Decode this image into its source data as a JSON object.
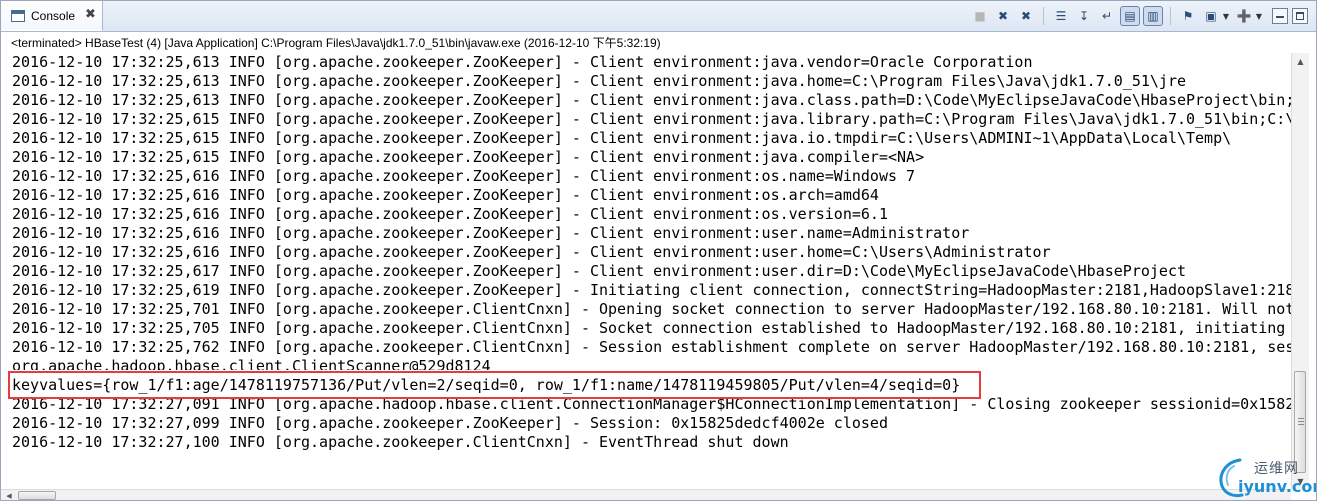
{
  "tab": {
    "title": "Console",
    "close_glyph": "✖"
  },
  "toolbar": {
    "icons": [
      {
        "name": "terminate-icon",
        "glyph": "■",
        "disabled": true
      },
      {
        "name": "remove-launch-icon",
        "glyph": "✖",
        "disabled": false
      },
      {
        "name": "remove-all-terminated-icon",
        "glyph": "✖",
        "disabled": false
      },
      {
        "name": "clear-console-icon",
        "glyph": "☰",
        "disabled": false
      },
      {
        "name": "scroll-lock-icon",
        "glyph": "↧",
        "disabled": false
      },
      {
        "name": "word-wrap-icon",
        "glyph": "↵",
        "disabled": false
      },
      {
        "name": "show-when-stdout-icon",
        "glyph": "▤",
        "pressed": true
      },
      {
        "name": "show-when-stderr-icon",
        "glyph": "▥",
        "pressed": true
      },
      {
        "name": "pin-console-icon",
        "glyph": "⚑",
        "disabled": false
      },
      {
        "name": "display-selected-console-icon",
        "glyph": "▣",
        "disabled": false
      },
      {
        "name": "open-console-icon",
        "glyph": "➕",
        "disabled": false
      }
    ]
  },
  "status": "<terminated> HBaseTest (4) [Java Application] C:\\Program Files\\Java\\jdk1.7.0_51\\bin\\javaw.exe (2016-12-10 下午5:32:19)",
  "console_lines": [
    "2016-12-10 17:32:25,613 INFO [org.apache.zookeeper.ZooKeeper] - Client environment:java.vendor=Oracle Corporation",
    "2016-12-10 17:32:25,613 INFO [org.apache.zookeeper.ZooKeeper] - Client environment:java.home=C:\\Program Files\\Java\\jdk1.7.0_51\\jre",
    "2016-12-10 17:32:25,613 INFO [org.apache.zookeeper.ZooKeeper] - Client environment:java.class.path=D:\\Code\\MyEclipseJavaCode\\HbaseProject\\bin;",
    "2016-12-10 17:32:25,615 INFO [org.apache.zookeeper.ZooKeeper] - Client environment:java.library.path=C:\\Program Files\\Java\\jdk1.7.0_51\\bin;C:\\",
    "2016-12-10 17:32:25,615 INFO [org.apache.zookeeper.ZooKeeper] - Client environment:java.io.tmpdir=C:\\Users\\ADMINI~1\\AppData\\Local\\Temp\\",
    "2016-12-10 17:32:25,615 INFO [org.apache.zookeeper.ZooKeeper] - Client environment:java.compiler=<NA>",
    "2016-12-10 17:32:25,616 INFO [org.apache.zookeeper.ZooKeeper] - Client environment:os.name=Windows 7",
    "2016-12-10 17:32:25,616 INFO [org.apache.zookeeper.ZooKeeper] - Client environment:os.arch=amd64",
    "2016-12-10 17:32:25,616 INFO [org.apache.zookeeper.ZooKeeper] - Client environment:os.version=6.1",
    "2016-12-10 17:32:25,616 INFO [org.apache.zookeeper.ZooKeeper] - Client environment:user.name=Administrator",
    "2016-12-10 17:32:25,616 INFO [org.apache.zookeeper.ZooKeeper] - Client environment:user.home=C:\\Users\\Administrator",
    "2016-12-10 17:32:25,617 INFO [org.apache.zookeeper.ZooKeeper] - Client environment:user.dir=D:\\Code\\MyEclipseJavaCode\\HbaseProject",
    "2016-12-10 17:32:25,619 INFO [org.apache.zookeeper.ZooKeeper] - Initiating client connection, connectString=HadoopMaster:2181,HadoopSlave1:218",
    "2016-12-10 17:32:25,701 INFO [org.apache.zookeeper.ClientCnxn] - Opening socket connection to server HadoopMaster/192.168.80.10:2181. Will not",
    "2016-12-10 17:32:25,705 INFO [org.apache.zookeeper.ClientCnxn] - Socket connection established to HadoopMaster/192.168.80.10:2181, initiating",
    "2016-12-10 17:32:25,762 INFO [org.apache.zookeeper.ClientCnxn] - Session establishment complete on server HadoopMaster/192.168.80.10:2181, ses"
  ],
  "clipped_line": "org.apache.hadoop.hbase.client.ClientScanner@529d8124",
  "keyvalues_line": "keyvalues={row_1/f1:age/1478119757136/Put/vlen=2/seqid=0, row_1/f1:name/1478119459805/Put/vlen=4/seqid=0}",
  "tail_lines": [
    "2016-12-10 17:32:27,091 INFO [org.apache.hadoop.hbase.client.ConnectionManager$HConnectionImplementation] - Closing zookeeper sessionid=0x1582",
    "2016-12-10 17:32:27,099 INFO [org.apache.zookeeper.ZooKeeper] - Session: 0x15825dedcf4002e closed",
    "2016-12-10 17:32:27,100 INFO [org.apache.zookeeper.ClientCnxn] - EventThread shut down"
  ],
  "highlight_color": "#e53c3c",
  "watermark": {
    "top": "运维网",
    "bottom": "iyunv.com"
  }
}
